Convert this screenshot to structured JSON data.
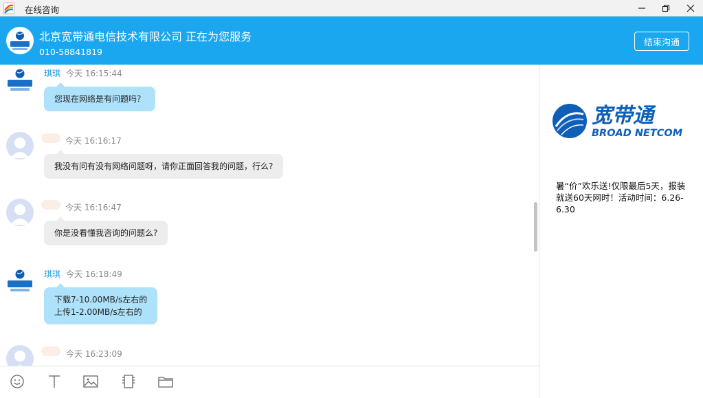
{
  "window": {
    "title": "在线咨询"
  },
  "header": {
    "title": "北京宽带通电信技术有限公司 正在为您服务",
    "phone": "010-58841819",
    "end_button": "结束沟通"
  },
  "messages": [
    {
      "sender": "琪琪",
      "time": "今天 16:15:44",
      "lines": [
        "您现在网络是有问题吗？"
      ],
      "role": "agent"
    },
    {
      "sender": "",
      "time": "今天 16:16:17",
      "lines": [
        "我没有问有没有网络问题呀，请你正面回答我的问题，行么?"
      ],
      "role": "user"
    },
    {
      "sender": "",
      "time": "今天 16:16:47",
      "lines": [
        "你是没看懂我咨询的问题么?"
      ],
      "role": "user"
    },
    {
      "sender": "琪琪",
      "time": "今天 16:18:49",
      "lines": [
        "下载7-10.00MB/s左右的",
        "上传1-2.00MB/s左右的"
      ],
      "role": "agent"
    },
    {
      "sender": "",
      "time": "今天 16:23:09",
      "lines": [],
      "role": "user"
    }
  ],
  "toolbar": {
    "icons": [
      "emoji-icon",
      "text-format-icon",
      "image-icon",
      "screenshot-icon",
      "folder-icon"
    ]
  },
  "side_panel": {
    "logo_text_cn": "宽带通",
    "logo_text_en": "BROAD NETCOM",
    "promo": "暑“价”欢乐送!仅限最后5天，报装就送60天网时！活动时间：6.26-6.30"
  },
  "colors": {
    "header_bg": "#1aa7f0",
    "agent_bubble": "#aee2fb",
    "user_bubble": "#ededed",
    "agent_name": "#1a9ee0"
  }
}
